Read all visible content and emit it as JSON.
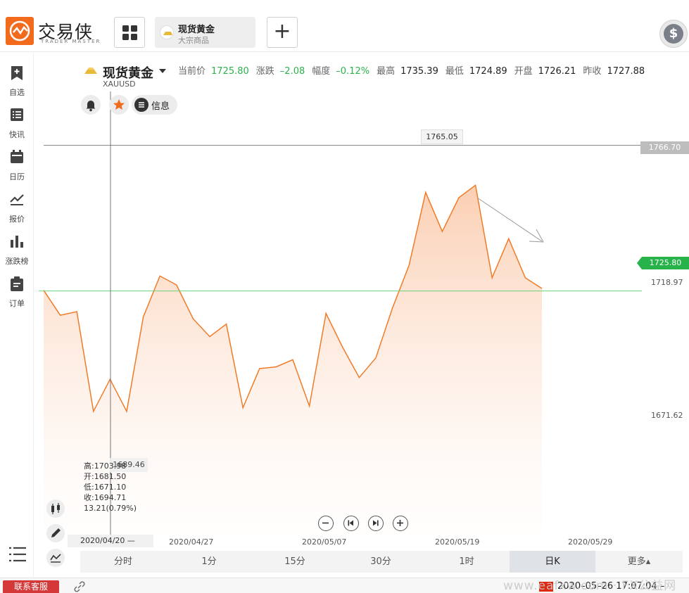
{
  "header": {
    "logo_cn": "交易侠",
    "logo_en": "TRADER MASTER",
    "tab_title": "现货黄金",
    "tab_sub": "大宗商品",
    "add_label": "+",
    "coin_label": "$"
  },
  "sidebar": {
    "items": [
      {
        "label": "自选",
        "icon": "bookmark-add-icon"
      },
      {
        "label": "快讯",
        "icon": "news-list-icon"
      },
      {
        "label": "日历",
        "icon": "calendar-icon"
      },
      {
        "label": "报价",
        "icon": "trend-line-icon"
      },
      {
        "label": "涨跌榜",
        "icon": "bar-chart-icon"
      },
      {
        "label": "订单",
        "icon": "clipboard-icon"
      }
    ]
  },
  "instrument": {
    "name": "现货黄金",
    "code": "XAUUSD",
    "current_label": "当前价",
    "current_value": "1725.80",
    "change_label": "涨跌",
    "change_value": "–2.08",
    "pct_label": "幅度",
    "pct_value": "–0.12%",
    "high_label": "最高",
    "high_value": "1735.39",
    "low_label": "最低",
    "low_value": "1724.89",
    "open_label": "开盘",
    "open_value": "1726.21",
    "prev_label": "昨收",
    "prev_value": "1727.88",
    "info_label": "信息"
  },
  "chart_data": {
    "type": "area",
    "series": [
      {
        "values": [
          1726.0,
          1719.0,
          1720.0,
          1692.0,
          1701.0,
          1692.0,
          1718.5,
          1730.0,
          1727.5,
          1718.0,
          1713.0,
          1716.5,
          1693.0,
          1704.0,
          1704.5,
          1706.5,
          1693.5,
          1719.5,
          1710.0,
          1701.5,
          1707.0,
          1721.0,
          1733.0,
          1753.5,
          1742.5,
          1752.0,
          1755.5,
          1729.5,
          1740.5,
          1729.5,
          1726.5
        ]
      }
    ],
    "x_tick_labels": [
      "2020/04/27",
      "2020/05/07",
      "2020/05/19",
      "2020/05/29"
    ],
    "y_tick_labels": [
      "1718.97",
      "1671.62"
    ],
    "ylim": [
      1641.0,
      1807.5
    ],
    "crosshair_price": "1765.05",
    "crosshair_tag": "1766.70",
    "current_price_tag": "1725.80",
    "current_price": 1725.8,
    "crosshair_level": 1766.7
  },
  "ohlc": {
    "high": "高:1703.98",
    "open": "开:1681.50",
    "low": "低:1671.10",
    "close": "收:1694.71",
    "change": "13.21(0.79%)",
    "box_value": "1689.46",
    "date": "2020/04/20 —"
  },
  "periods": [
    "分时",
    "1分",
    "15分",
    "30分",
    "1时",
    "日K",
    "更多▴"
  ],
  "active_period": "日K",
  "footer": {
    "service": "联系客服",
    "datetime": "2020–05–26 17:07:04 –",
    "watermark": "www.eafxw.com · FX公益网"
  },
  "colors": {
    "accent": "#f26b1d",
    "line": "#f07b28",
    "up": "#27b24a",
    "service": "#d43838"
  }
}
